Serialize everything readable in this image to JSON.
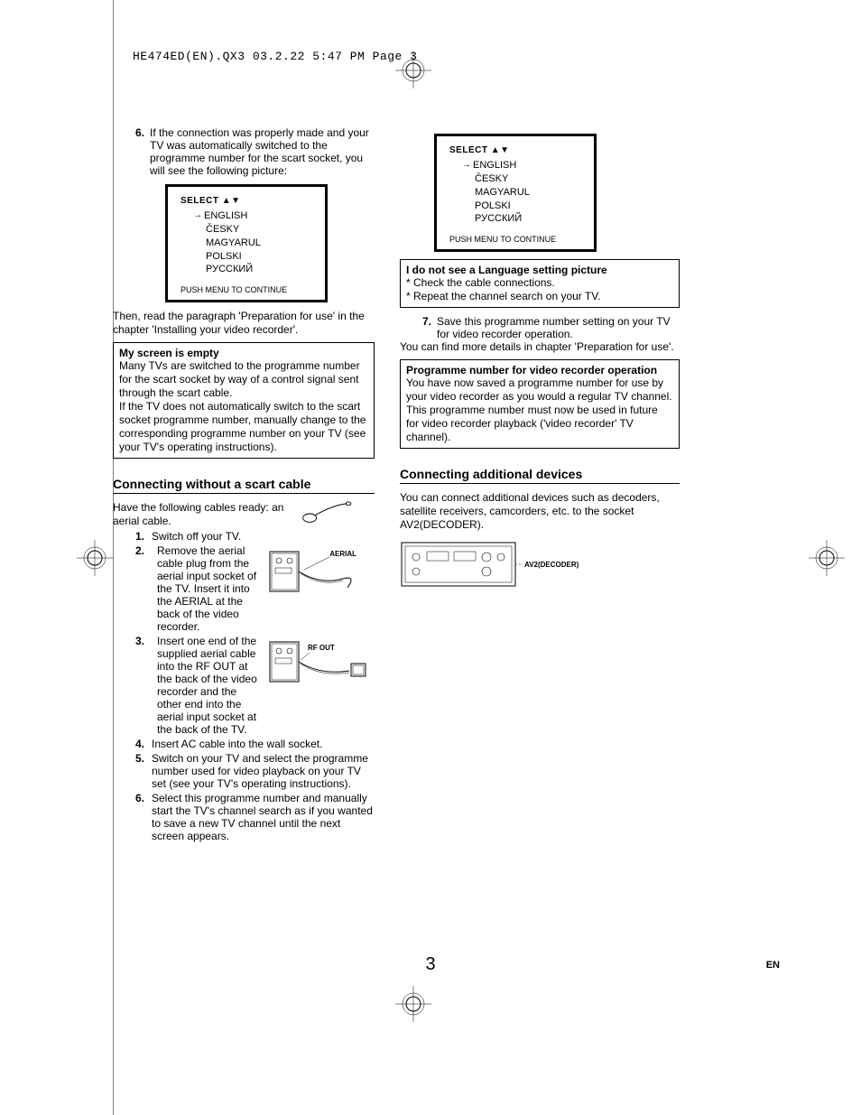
{
  "header": "HE474ED(EN).QX3  03.2.22  5:47 PM  Page 3",
  "col1": {
    "step6_num": "6.",
    "step6_text": "If the connection was properly made and your TV was automatically switched to the programme number for the scart socket, you will see the following picture:",
    "tv": {
      "select": "SELECT ▲▼",
      "langs": [
        "ENGLISH",
        "ČESKY",
        "MAGYARUL",
        "POLSKI",
        "РУССКИЙ"
      ],
      "push": "PUSH MENU TO CONTINUE"
    },
    "para_then": "Then, read the paragraph 'Preparation for use' in the chapter 'Installing your video recorder'.",
    "box_empty": {
      "title": "My screen is empty",
      "p1": "Many TVs are switched to the programme number for the scart socket by way of a control signal sent through the scart cable.",
      "p2": "If the TV does not automatically switch to the scart socket programme number, manually change to the corresponding programme number on your TV (see your TV's operating instructions)."
    },
    "h2_without": "Connecting without a scart cable",
    "intro_without": "Have the following cables ready: an aerial cable.",
    "steps": {
      "s1n": "1.",
      "s1t": "Switch off your TV.",
      "s2n": "2.",
      "s2t": "Remove the aerial cable plug from the aerial input socket of the TV. Insert it into the AERIAL at the back of the video recorder.",
      "s3n": "3.",
      "s3t": "Insert one end of the supplied aerial cable into the RF OUT at the back of the video recorder and the other end into the aerial input socket at the back of the TV.",
      "s4n": "4.",
      "s4t": "Insert AC cable into the wall socket.",
      "s5n": "5.",
      "s5t": "Switch on your TV and select the programme number used for video playback on your TV set (see your TV's operating instructions).",
      "s6n": "6.",
      "s6t": "Select this programme number and manually start the TV's channel search as if you wanted to save a new TV channel until the next screen appears."
    },
    "fig_aerial": "AERIAL",
    "fig_rfout": "RF OUT"
  },
  "col2": {
    "tv": {
      "select": "SELECT ▲▼",
      "langs": [
        "ENGLISH",
        "ČESKY",
        "MAGYARUL",
        "POLSKI",
        "РУССКИЙ"
      ],
      "push": "PUSH MENU TO CONTINUE"
    },
    "box_lang": {
      "title": "I do not see a Language setting picture",
      "b1": "* Check the cable connections.",
      "b2": "* Repeat the channel search on your TV."
    },
    "step7_num": "7.",
    "step7_text": "Save this programme number setting on your TV for video recorder operation.",
    "para_find": "You can find more details in chapter 'Preparation for use'.",
    "box_prog": {
      "title": "Programme number for video recorder operation",
      "body": "You have now saved a programme number for use by your video recorder as you would a regular TV channel. This programme number must now be used in future for video recorder playback ('video recorder' TV channel)."
    },
    "h2_add": "Connecting additional devices",
    "para_add": "You can connect additional devices such as decoders, satellite receivers, camcorders, etc. to the socket AV2(DECODER).",
    "fig_decoder": "AV2(DECODER)"
  },
  "page_number": "3",
  "page_lang": "EN"
}
